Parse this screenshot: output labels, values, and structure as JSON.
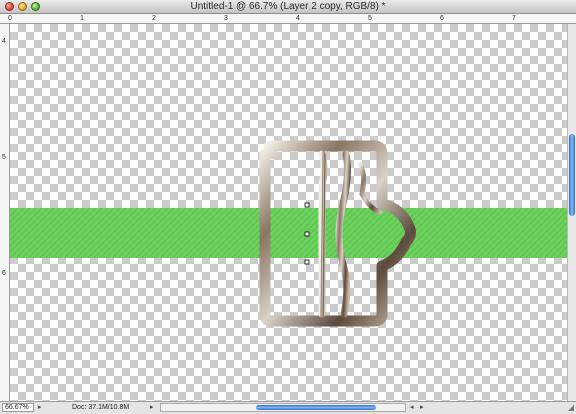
{
  "window": {
    "title": "Untitled-1 @ 66.7% (Layer 2 copy, RGB/8) *",
    "traffic_lights": [
      "close",
      "minimize",
      "zoom"
    ]
  },
  "rulers": {
    "horizontal_labels": [
      "0",
      "1",
      "2",
      "3",
      "4",
      "5",
      "6",
      "7"
    ],
    "vertical_labels": [
      "4",
      "5",
      "6"
    ]
  },
  "canvas": {
    "background": "transparent-checkerboard",
    "strap_color": "#6bd15c",
    "buckle": "metallic-buckle"
  },
  "status": {
    "zoom": "66.67%",
    "doc": "Doc: 37.1M/10.8M"
  },
  "icons": {
    "status_menu": "triangle-right-icon",
    "scroll_left": "arrow-left-icon",
    "scroll_right": "arrow-right-icon"
  }
}
